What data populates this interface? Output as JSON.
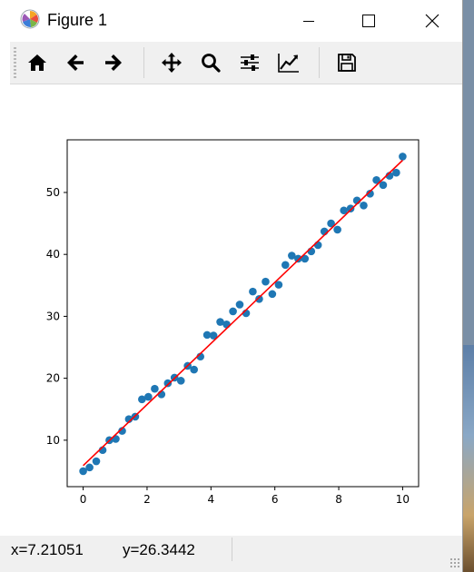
{
  "window": {
    "title": "Figure 1",
    "app_icon": "matplotlib-icon",
    "controls": [
      "minimize-icon",
      "maximize-icon",
      "close-icon"
    ]
  },
  "toolbar": {
    "buttons": [
      {
        "icon": "home-icon",
        "tooltip": "Home"
      },
      {
        "icon": "back-arrow-icon",
        "tooltip": "Back"
      },
      {
        "icon": "forward-arrow-icon",
        "tooltip": "Forward"
      },
      {
        "icon": "pan-icon",
        "tooltip": "Pan"
      },
      {
        "icon": "zoom-icon",
        "tooltip": "Zoom"
      },
      {
        "icon": "subplots-config-icon",
        "tooltip": "Subplots"
      },
      {
        "icon": "edit-curve-icon",
        "tooltip": "Customize"
      },
      {
        "icon": "save-icon",
        "tooltip": "Save"
      }
    ]
  },
  "status": {
    "x": "x=7.21051",
    "y": "y=26.3442"
  },
  "chart_data": {
    "type": "scatter",
    "title": "",
    "xlabel": "",
    "ylabel": "",
    "xlim": [
      -0.5,
      10.5
    ],
    "ylim": [
      2.5,
      58.5
    ],
    "xticks": [
      "0",
      "2",
      "4",
      "6",
      "8",
      "10"
    ],
    "yticks": [
      "10",
      "20",
      "30",
      "40",
      "50"
    ],
    "grid": false,
    "colors": {
      "points": "#1f77b4",
      "fit_line": "#ff0000"
    },
    "series": [
      {
        "kind": "scatter",
        "x": [
          0.0,
          0.2,
          0.41,
          0.61,
          0.82,
          1.02,
          1.22,
          1.43,
          1.63,
          1.84,
          2.04,
          2.24,
          2.45,
          2.65,
          2.86,
          3.06,
          3.27,
          3.47,
          3.67,
          3.88,
          4.08,
          4.29,
          4.49,
          4.69,
          4.9,
          5.1,
          5.31,
          5.51,
          5.71,
          5.92,
          6.12,
          6.33,
          6.53,
          6.73,
          6.94,
          7.14,
          7.35,
          7.55,
          7.76,
          7.96,
          8.16,
          8.37,
          8.57,
          8.78,
          8.98,
          9.18,
          9.39,
          9.59,
          9.8,
          10.0
        ],
        "y": [
          5.0,
          5.6,
          6.6,
          8.4,
          10.0,
          10.2,
          11.5,
          13.4,
          13.8,
          16.6,
          17.0,
          18.3,
          17.4,
          19.2,
          20.1,
          19.6,
          22.0,
          21.4,
          23.5,
          27.0,
          26.9,
          29.1,
          28.7,
          30.8,
          31.9,
          30.5,
          34.0,
          32.8,
          35.6,
          33.6,
          35.1,
          38.3,
          39.8,
          39.3,
          39.3,
          40.5,
          41.5,
          43.7,
          45.0,
          44.0,
          47.1,
          47.4,
          48.7,
          47.9,
          49.8,
          52.0,
          51.2,
          52.7,
          53.2,
          55.8
        ]
      },
      {
        "kind": "line",
        "x": [
          0,
          10
        ],
        "y": [
          5.9,
          55.2
        ]
      }
    ]
  }
}
